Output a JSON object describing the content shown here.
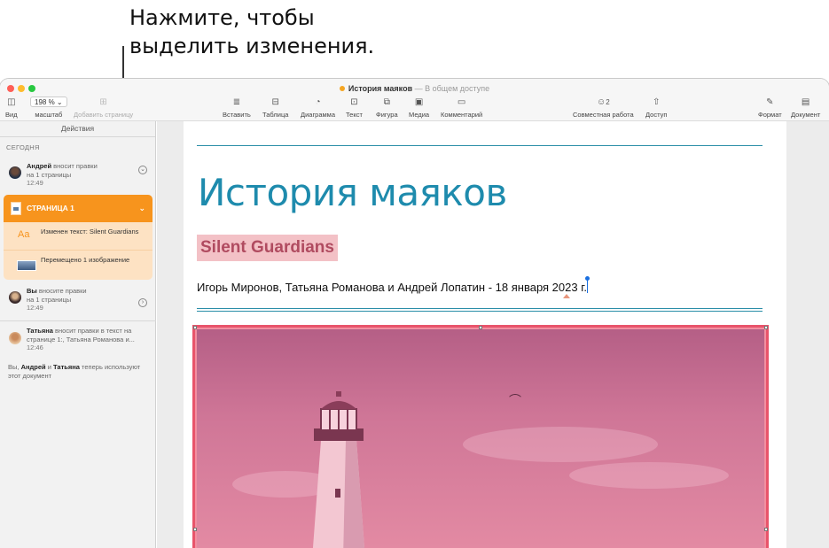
{
  "callout": {
    "line1": "Нажмите, чтобы",
    "line2": "выделить изменения."
  },
  "window": {
    "title": "История маяков",
    "shared_status": "— В общем доступе"
  },
  "toolbar": {
    "view": "Вид",
    "zoom_value": "198 %",
    "zoom_label": "масштаб",
    "add_page": "Добавить страницу",
    "insert": "Вставить",
    "table": "Таблица",
    "chart": "Диаграмма",
    "text": "Текст",
    "shape": "Фигура",
    "media": "Медиа",
    "comment": "Комментарий",
    "collab": "Совместная работа",
    "collab_count": "2",
    "share": "Доступ",
    "format": "Формат",
    "document": "Документ"
  },
  "sidebar": {
    "header": "Действия",
    "section_today": "СЕГОДНЯ",
    "entry1": {
      "who": "Андрей",
      "action": " вносит правки",
      "detail": "на 1 страницы",
      "time": "12:49"
    },
    "page_group": {
      "title": "СТРАНИЦА 1",
      "row1": "Изменен текст: Silent Guardians",
      "row1_icon": "Aa",
      "row2": "Перемещено 1 изображение"
    },
    "entry2": {
      "who": "Вы",
      "action": " вносите правки",
      "detail": "на 1 страницы",
      "time": "12:49"
    },
    "entry3": {
      "who": "Татьяна",
      "action": " вносит правки в текст на странице 1:, Татьяна Романова и...",
      "time": "12:46"
    },
    "entry4": {
      "prefix": "Вы, ",
      "who1": "Андрей",
      "mid": " и ",
      "who2": "Татьяна",
      "suffix": " теперь используют этот документ"
    }
  },
  "document": {
    "title": "История маяков",
    "subtitle": "Silent Guardians",
    "authors": "Игорь Миронов, Татьяна Романова и Андрей Лопатин - 18 января 2023 г."
  },
  "colors": {
    "accent_orange": "#f7941d",
    "title_blue": "#1e8bad",
    "highlight_pink": "#f3c1c6"
  }
}
